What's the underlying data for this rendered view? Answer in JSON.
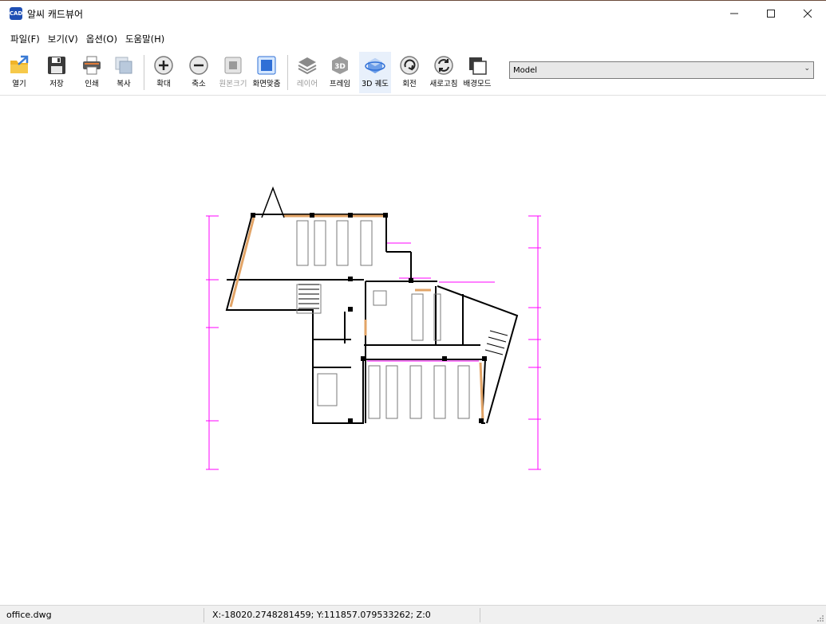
{
  "window": {
    "title": "알씨 캐드뷰어"
  },
  "menu": {
    "items": [
      "파일(F)",
      "보기(V)",
      "옵션(O)",
      "도움말(H)"
    ]
  },
  "toolbar": {
    "open": "열기",
    "save": "저장",
    "print": "인쇄",
    "copy": "복사",
    "zoom_in": "확대",
    "zoom_out": "축소",
    "original_size": "원본크기",
    "fit_screen": "화면맞춤",
    "layer": "레이어",
    "wireframe": "프레임",
    "orbit_3d": "3D 궤도",
    "rotate": "회전",
    "refresh": "새로고침",
    "background_mode": "배경모드"
  },
  "layout_select": {
    "value": "Model"
  },
  "status": {
    "filename": "office.dwg",
    "coordinates": "X:-18020.2748281459; Y:111857.079533262; Z:0"
  },
  "colors": {
    "dimension": "#ff00ff",
    "wall": "#000000",
    "wood": "#e2a467",
    "accent": "#1f4fb4"
  }
}
